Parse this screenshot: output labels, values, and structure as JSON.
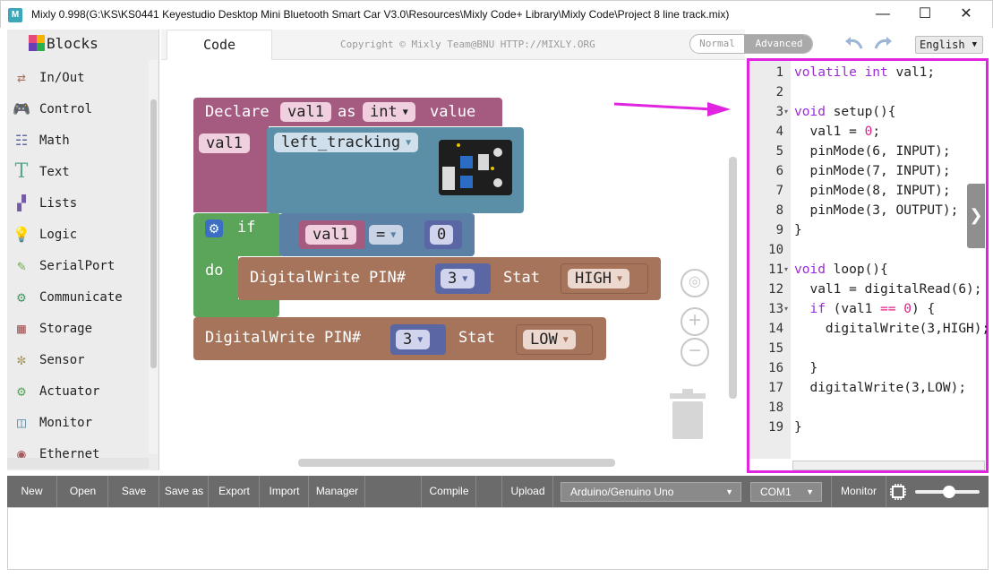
{
  "window": {
    "title": "Mixly 0.998(G:\\KS\\KS0441 Keyestudio Desktop Mini Bluetooth Smart Car V3.0\\Resources\\Mixly Code+ Library\\Mixly Code\\Project 8 line track.mix)",
    "app_icon_text": "M"
  },
  "sidebar": {
    "heading": "Blocks",
    "categories": [
      {
        "label": "In/Out",
        "icon": "inout-icon"
      },
      {
        "label": "Control",
        "icon": "control-icon"
      },
      {
        "label": "Math",
        "icon": "math-icon"
      },
      {
        "label": "Text",
        "icon": "text-icon"
      },
      {
        "label": "Lists",
        "icon": "lists-icon"
      },
      {
        "label": "Logic",
        "icon": "logic-icon"
      },
      {
        "label": "SerialPort",
        "icon": "serialport-icon"
      },
      {
        "label": "Communicate",
        "icon": "communicate-icon"
      },
      {
        "label": "Storage",
        "icon": "storage-icon"
      },
      {
        "label": "Sensor",
        "icon": "sensor-icon"
      },
      {
        "label": "Actuator",
        "icon": "actuator-icon"
      },
      {
        "label": "Monitor",
        "icon": "monitor-icon"
      },
      {
        "label": "Ethernet",
        "icon": "ethernet-icon"
      }
    ]
  },
  "tabbar": {
    "code_tab": "Code",
    "copyright": "Copyright © Mixly Team@BNU HTTP://MIXLY.ORG",
    "mode_normal": "Normal",
    "mode_advanced": "Advanced",
    "language": "English"
  },
  "blocks": {
    "declare": {
      "kw": "Declare",
      "var": "val1",
      "as": "as",
      "type": "int",
      "value": "value"
    },
    "value_var": "val1",
    "sensor": "left_tracking",
    "if": {
      "kw": "if",
      "do": "do",
      "var": "val1",
      "op": "=",
      "num": "0"
    },
    "write1": {
      "label": "DigitalWrite PIN#",
      "pin": "3",
      "stat": "Stat",
      "level": "HIGH"
    },
    "write2": {
      "label": "DigitalWrite PIN#",
      "pin": "3",
      "stat": "Stat",
      "level": "LOW"
    }
  },
  "code": {
    "line_numbers": [
      "1",
      "2",
      "3",
      "4",
      "5",
      "6",
      "7",
      "8",
      "9",
      "10",
      "11",
      "12",
      "13",
      "14",
      "15",
      "16",
      "17",
      "18",
      "19"
    ]
  },
  "toolbar": {
    "new": "New",
    "open": "Open",
    "save": "Save",
    "save_as": "Save as",
    "export": "Export",
    "import": "Import",
    "manager": "Manager",
    "compile": "Compile",
    "upload": "Upload",
    "board": "Arduino/Genuino Uno",
    "port": "COM1",
    "monitor": "Monitor"
  },
  "colors": {
    "variable_block": "#a55b80",
    "sensor_block": "#5b8fa8",
    "logic_block": "#5ba55b",
    "io_block": "#a5745b",
    "highlight": "#e024e0"
  }
}
